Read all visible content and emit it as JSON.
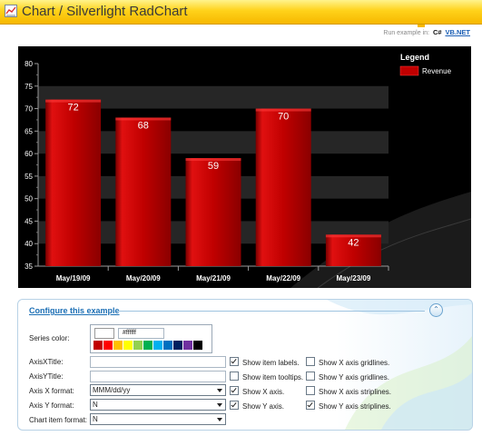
{
  "header": {
    "title": "Chart / Silverlight RadChart",
    "icon": "chart-icon"
  },
  "run_example": {
    "label": "Run example in:",
    "csharp": "C#",
    "vbnet": "VB.NET"
  },
  "chart_data": {
    "type": "bar",
    "categories": [
      "May/19/09",
      "May/20/09",
      "May/21/09",
      "May/22/09",
      "May/23/09"
    ],
    "series": [
      {
        "name": "Revenue",
        "values": [
          72,
          68,
          59,
          70,
          42
        ],
        "color": "#c00000"
      }
    ],
    "ylim": [
      35,
      80
    ],
    "yticks": [
      35,
      40,
      45,
      50,
      55,
      60,
      65,
      70,
      75,
      80
    ],
    "legend": {
      "title": "Legend",
      "placement": "top-right"
    },
    "background": "#000000",
    "stripes": true
  },
  "config": {
    "title": "Configure this example",
    "series_color_label": "Series color:",
    "series_color_value": "#ffffff",
    "palette": [
      "#c00000",
      "#ff0000",
      "#ffc000",
      "#ffff00",
      "#92d050",
      "#00b050",
      "#00b0f0",
      "#0070c0",
      "#002060",
      "#7030a0",
      "#000000"
    ],
    "axis_x_title_label": "AxisXTitle:",
    "axis_x_title_value": "",
    "axis_y_title_label": "AxisYTitle:",
    "axis_y_title_value": "",
    "axis_x_format_label": "Axis X format:",
    "axis_x_format_value": "MMM/dd/yy",
    "axis_y_format_label": "Axis Y format:",
    "axis_y_format_value": "N",
    "chart_item_format_label": "Chart item format:",
    "chart_item_format_value": "N",
    "checkboxes": [
      {
        "label": "Show item labels.",
        "checked": true
      },
      {
        "label": "Show item tooltips.",
        "checked": false
      },
      {
        "label": "Show X axis.",
        "checked": true
      },
      {
        "label": "Show Y axis.",
        "checked": true
      },
      {
        "label": "Show X axis gridlines.",
        "checked": false
      },
      {
        "label": "Show Y axis gridlines.",
        "checked": false
      },
      {
        "label": "Show X axis striplines.",
        "checked": false
      },
      {
        "label": "Show Y axis striplines.",
        "checked": true
      }
    ]
  }
}
